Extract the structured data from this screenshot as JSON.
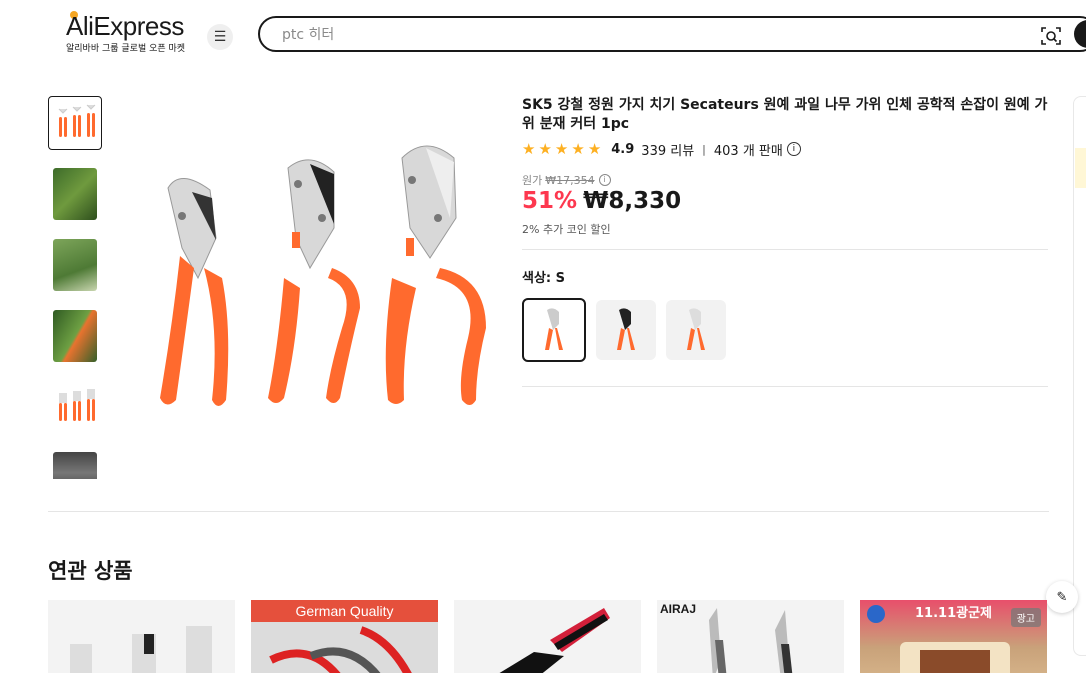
{
  "header": {
    "logo_text": "AliExpress",
    "logo_subtitle": "알리바바 그룹 글로벌 오픈 마켓",
    "search_placeholder": "ptc 히터",
    "icons": {
      "menu": "menu-icon",
      "camera": "camera-search-icon"
    }
  },
  "product": {
    "title": "SK5 강철 정원 가지 치기 Secateurs 원예 과일 나무 가위 인체 공학적 손잡이 원예 가위 분재 커터 1pc",
    "rating": "4.9",
    "stars": 5,
    "reviews": "339 리뷰",
    "separator": "|",
    "sold": "403 개 판매",
    "original_label": "원가",
    "original_price": "₩17,354",
    "discount": "51%",
    "price": "₩8,330",
    "coin_discount": "2% 추가 코인 할인",
    "color_label": "색상: S",
    "selected_swatch": 0
  },
  "related": {
    "title": "연관 상품",
    "cards": [
      {
        "banner": "",
        "brand": "",
        "ad": ""
      },
      {
        "banner": "German Quality",
        "brand": "",
        "ad": ""
      },
      {
        "banner": "",
        "brand": "",
        "ad": ""
      },
      {
        "banner": "",
        "brand": "AIRAJ",
        "ad": ""
      },
      {
        "banner": "",
        "brand": "",
        "ad": "광고",
        "promo": "11.11광군제"
      }
    ]
  },
  "colors": {
    "accent": "#fd384f",
    "star": "#fdb022",
    "handle": "#ff6a2e"
  }
}
